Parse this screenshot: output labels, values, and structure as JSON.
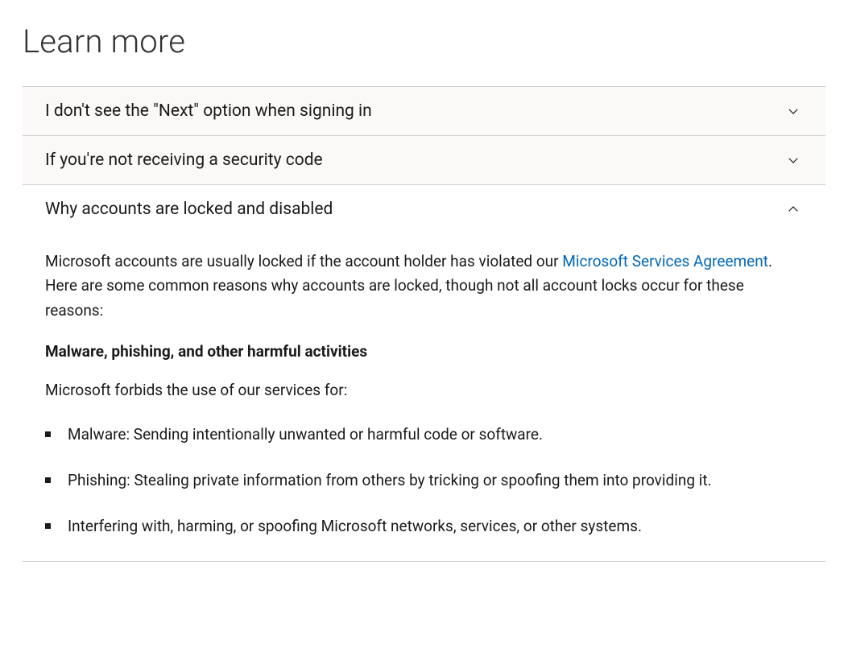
{
  "page": {
    "title": "Learn more"
  },
  "accordion": {
    "items": [
      {
        "title": "I don't see the \"Next\" option when signing in",
        "expanded": false
      },
      {
        "title": "If you're not receiving a security code",
        "expanded": false
      },
      {
        "title": "Why accounts are locked and disabled",
        "expanded": true
      }
    ]
  },
  "content": {
    "intro_pre": "Microsoft accounts are usually locked if the account holder has violated our ",
    "intro_link": "Microsoft Services Agreement",
    "intro_post": ". Here are some common reasons why accounts are locked, though not all account locks occur for these reasons:",
    "subhead": "Malware, phishing, and other harmful activities",
    "forbids": "Microsoft forbids the use of our services for:",
    "bullets": [
      "Malware: Sending intentionally unwanted or harmful code or software.",
      "Phishing: Stealing private information from others by tricking or spoofing them into providing it.",
      "Interfering with, harming, or spoofing Microsoft networks, services, or other systems."
    ]
  },
  "colors": {
    "link": "#0067b8",
    "text": "#1b1a19",
    "border": "#d2d0ce",
    "collapsed_bg": "#faf9f8"
  }
}
